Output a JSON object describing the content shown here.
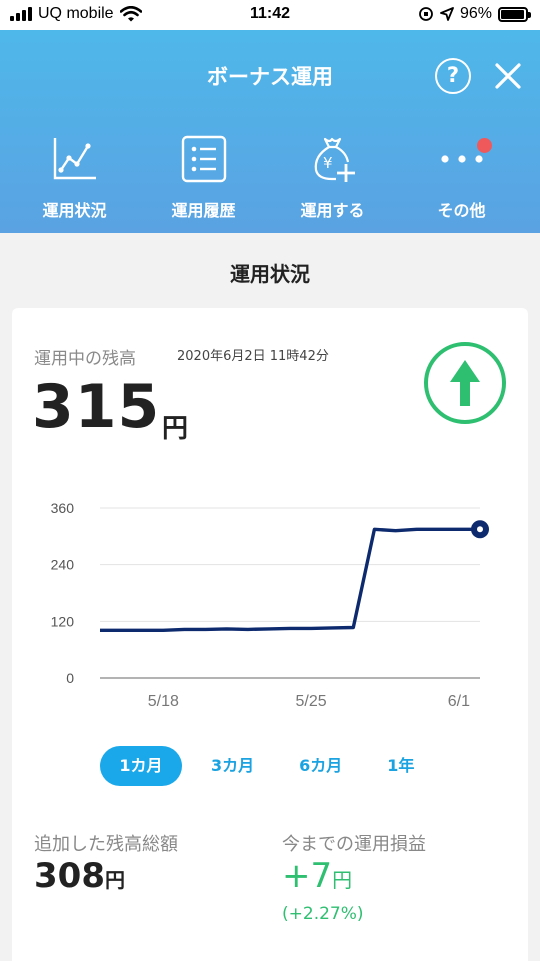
{
  "status_bar": {
    "carrier": "UQ mobile",
    "time": "11:42",
    "battery": "96%",
    "battery_level": 0.96
  },
  "header": {
    "title": "ボーナス運用",
    "help_glyph": "?"
  },
  "nav": [
    {
      "label": "運用状況",
      "icon": "chart-line-icon"
    },
    {
      "label": "運用履歴",
      "icon": "list-icon"
    },
    {
      "label": "運用する",
      "icon": "money-bag-plus-icon"
    },
    {
      "label": "その他",
      "icon": "more-dots-icon",
      "badge": true
    }
  ],
  "section_title": "運用状況",
  "balance": {
    "label": "運用中の残高",
    "datetime": "2020年6月2日 11時42分",
    "amount": "315",
    "unit": "円",
    "trend": "up-arrow-icon",
    "trend_color": "#2fbf71"
  },
  "chart_data": {
    "type": "line",
    "x": [
      "5/15",
      "5/16",
      "5/17",
      "5/18",
      "5/19",
      "5/20",
      "5/21",
      "5/22",
      "5/23",
      "5/24",
      "5/25",
      "5/26",
      "5/27",
      "5/28",
      "5/29",
      "5/30",
      "5/31",
      "6/1",
      "6/2"
    ],
    "series": [
      {
        "values": [
          101,
          101,
          101,
          101,
          103,
          103,
          104,
          103,
          104,
          105,
          105,
          106,
          107,
          315,
          312,
          315,
          315,
          315,
          315
        ]
      }
    ],
    "xticks": [
      "5/18",
      "5/25",
      "6/1"
    ],
    "yticks": [
      0,
      120,
      240,
      360
    ],
    "ylim": [
      0,
      360
    ],
    "grid": true,
    "line_color": "#0d2a6e"
  },
  "periods": [
    {
      "label": "1カ月",
      "active": true
    },
    {
      "label": "3カ月",
      "active": false
    },
    {
      "label": "6カ月",
      "active": false
    },
    {
      "label": "1年",
      "active": false
    }
  ],
  "stats": {
    "added_label": "追加した残高総額",
    "added_value": "308",
    "added_unit": "円",
    "pl_label": "今までの運用損益",
    "pl_value": "+7",
    "pl_unit": "円",
    "pl_pct": "(+2.27%)"
  }
}
